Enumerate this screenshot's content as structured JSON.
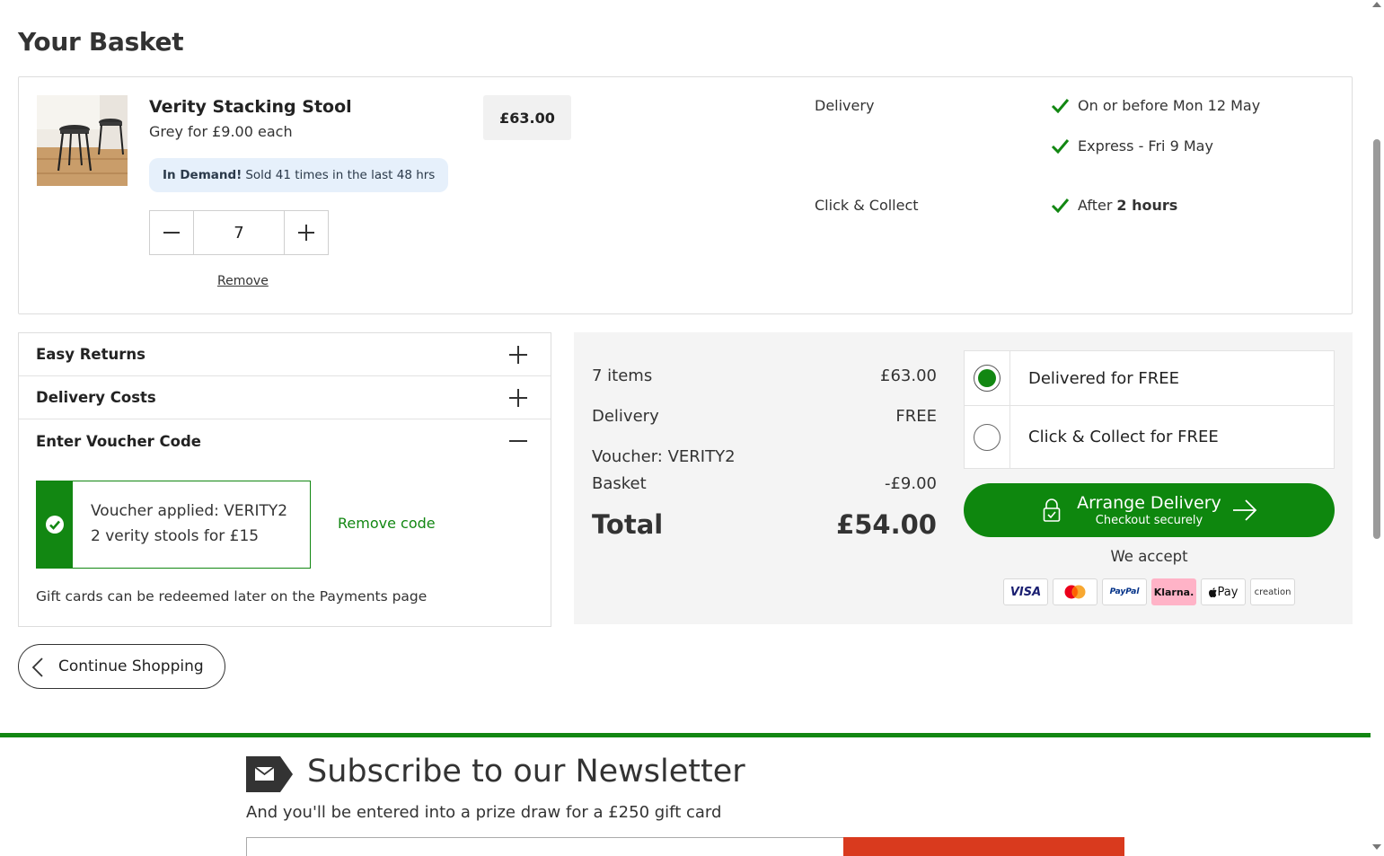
{
  "page": {
    "title": "Your Basket"
  },
  "basket_item": {
    "name": "Verity Stacking Stool",
    "variant": "Grey for £9.00 each",
    "demand_badge": {
      "strong": "In Demand!",
      "text": "Sold 41 times in the last 48 hrs"
    },
    "quantity": "7",
    "remove_label": "Remove",
    "line_price": "£63.00",
    "fulfilment": {
      "delivery_label": "Delivery",
      "delivery_option_1": "On or before Mon 12 May",
      "delivery_option_2": "Express - Fri 9 May",
      "collect_label": "Click & Collect",
      "collect_prefix": "After",
      "collect_strong": "2 hours"
    }
  },
  "accordion": {
    "easy_returns": "Easy Returns",
    "delivery_costs": "Delivery Costs",
    "voucher_code": "Enter Voucher Code",
    "voucher_applied": "Voucher applied: VERITY2",
    "voucher_desc": "2 verity stools for £15",
    "remove_code": "Remove code",
    "gift_card_note": "Gift cards can be redeemed later on the Payments page"
  },
  "summary": {
    "items_label": "7 items",
    "items_value": "£63.00",
    "delivery_label": "Delivery",
    "delivery_value": "FREE",
    "voucher_label": "Voucher: VERITY2",
    "basket_label": "Basket",
    "basket_value": "-£9.00",
    "total_label": "Total",
    "total_value": "£54.00",
    "options": [
      {
        "label": "Delivered for FREE",
        "selected": true
      },
      {
        "label": "Click & Collect for FREE",
        "selected": false
      }
    ],
    "checkout_main": "Arrange Delivery",
    "checkout_sub": "Checkout securely",
    "we_accept": "We accept",
    "payment_methods": [
      "VISA",
      "Mastercard",
      "PayPal",
      "Klarna.",
      "Pay",
      "creation"
    ]
  },
  "continue_shopping": "Continue Shopping",
  "newsletter": {
    "title": "Subscribe to our Newsletter",
    "subtitle": "And you'll be entered into a prize draw for a £250 gift card"
  },
  "colors": {
    "brand_green": "#128712",
    "demand_badge_bg": "#e6f0fb",
    "summary_bg": "#f4f4f4",
    "newsletter_button": "#d93a1e",
    "klarna_pink": "#ffb3c7"
  }
}
